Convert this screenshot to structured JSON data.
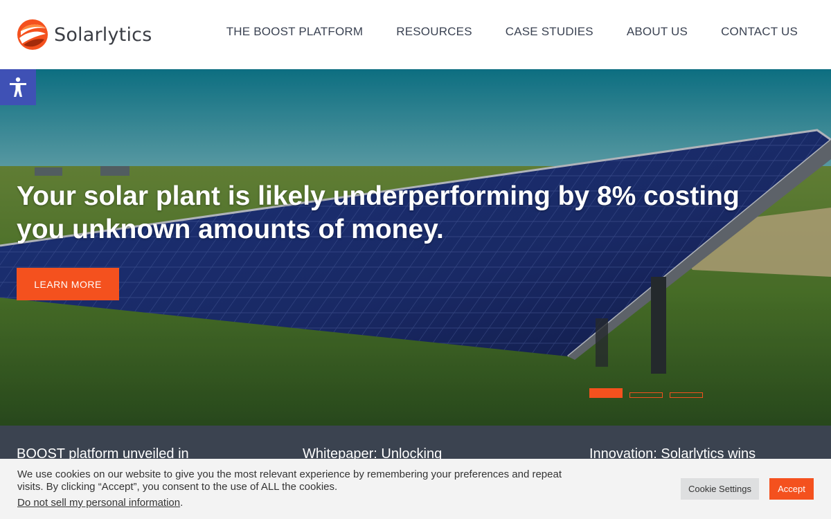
{
  "brand": {
    "name": "Solarlytics",
    "accent": "#f4511e"
  },
  "nav": {
    "items": [
      {
        "label": "THE BOOST PLATFORM"
      },
      {
        "label": "RESOURCES"
      },
      {
        "label": "CASE STUDIES"
      },
      {
        "label": "ABOUT US"
      },
      {
        "label": "CONTACT US"
      }
    ]
  },
  "accessibility": {
    "icon": "accessibility-icon"
  },
  "hero": {
    "title": "Your solar plant is likely underperforming by 8% costing you unknown amounts of money.",
    "button_label": "LEARN MORE",
    "slides": {
      "count": 3,
      "active": 1
    }
  },
  "news": {
    "items": [
      {
        "title": "BOOST platform unveiled in"
      },
      {
        "title": "Whitepaper: Unlocking"
      },
      {
        "title": "Innovation: Solarlytics wins"
      }
    ]
  },
  "cookie": {
    "text": "We use cookies on our website to give you the most relevant experience by remembering your preferences and repeat visits. By clicking “Accept”, you consent to the use of ALL the cookies.",
    "link": "Do not sell my personal information",
    "link_suffix": ".",
    "settings_label": "Cookie Settings",
    "accept_label": "Accept"
  }
}
